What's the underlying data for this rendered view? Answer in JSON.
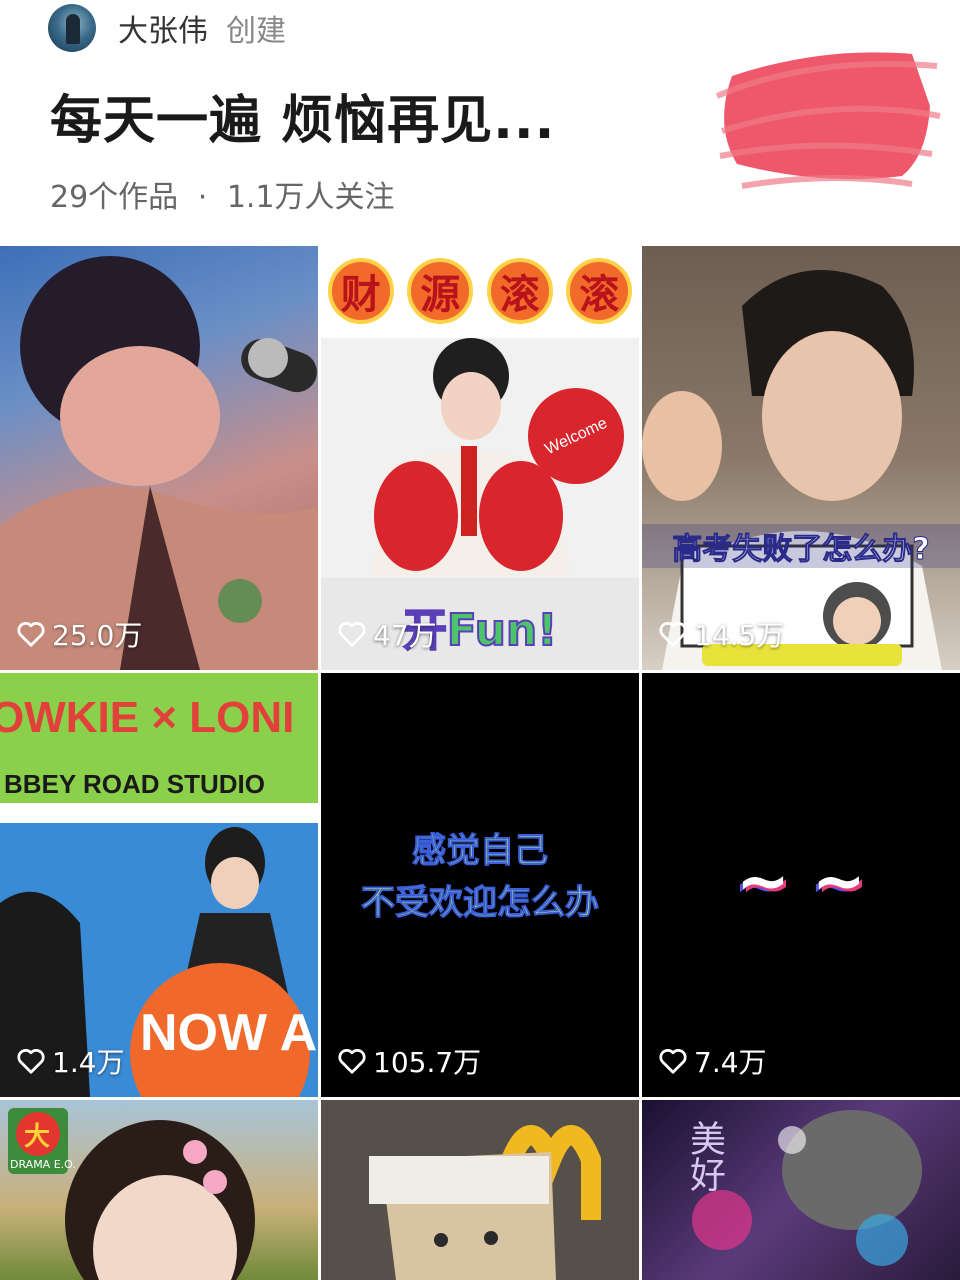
{
  "header": {
    "creator_name": "大张伟",
    "creator_action": "创建",
    "playlist_title": "每天一遍 烦恼再见...",
    "works_count": "29个作品",
    "separator": "·",
    "followers": "1.1万人关注"
  },
  "colors": {
    "scribble": "#ee4a5e",
    "like_text": "#ffffff"
  },
  "videos": [
    {
      "likes": "25.0万",
      "icon": "heart-outline-icon"
    },
    {
      "likes": "47万",
      "icon": "heart-outline-icon",
      "top_text": [
        "财",
        "源",
        "滚",
        "滚"
      ],
      "bottom_text": "开Fun!"
    },
    {
      "likes": "14.5万",
      "icon": "heart-outline-icon",
      "caption": "高考失败了怎么办?"
    },
    {
      "likes": "1.4万",
      "icon": "heart-outline-icon",
      "line1": "OWKIE × LONI",
      "line2": "BBEY ROAD STUDIO",
      "line3": "NOW AND"
    },
    {
      "likes": "105.7万",
      "icon": "heart-outline-icon",
      "line1": "感觉自己",
      "line2": "不受欢迎怎么办"
    },
    {
      "likes": "7.4万",
      "icon": "heart-outline-icon",
      "text": "~ ~"
    },
    {
      "badge": "大",
      "badge_sub": "DRAMA E.O."
    },
    {},
    {
      "text": "美好"
    }
  ]
}
